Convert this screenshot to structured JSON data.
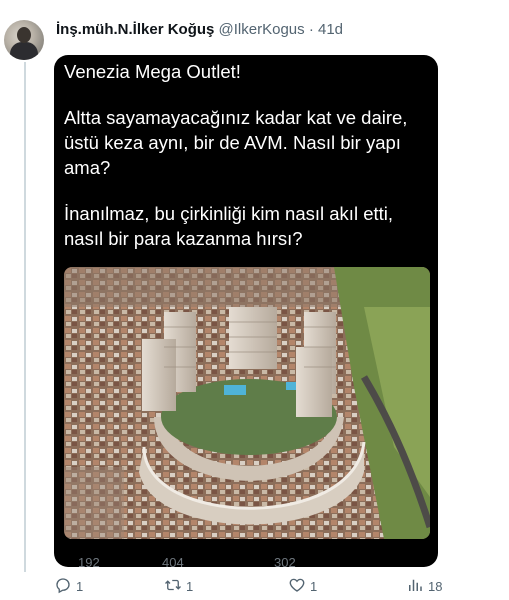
{
  "tweet": {
    "display_name": "İnş.müh.N.İlker Koğuş",
    "handle": "@IlkerKogus",
    "separator": "·",
    "time": "41d"
  },
  "media": {
    "text_lines": [
      "Venezia Mega Outlet!",
      "Altta sayamayacağınız kadar kat ve daire,",
      "üstü keza aynı, bir de AVM. Nasıl bir yapı",
      "ama?",
      "İnanılmaz, bu çirkinliği kim nasıl akıl etti,",
      "nasıl bir para kazanma hırsı?"
    ],
    "inner_stats": [
      "192",
      "404",
      "302"
    ]
  },
  "actions": {
    "replies": "1",
    "reposts": "1",
    "likes": "1",
    "views": "18"
  },
  "colors": {
    "text_primary": "#0f1419",
    "text_secondary": "#536471",
    "media_background": "#000000",
    "thread_line": "#cfd9de"
  },
  "icons": [
    "reply-icon",
    "repost-icon",
    "like-icon",
    "views-icon"
  ]
}
